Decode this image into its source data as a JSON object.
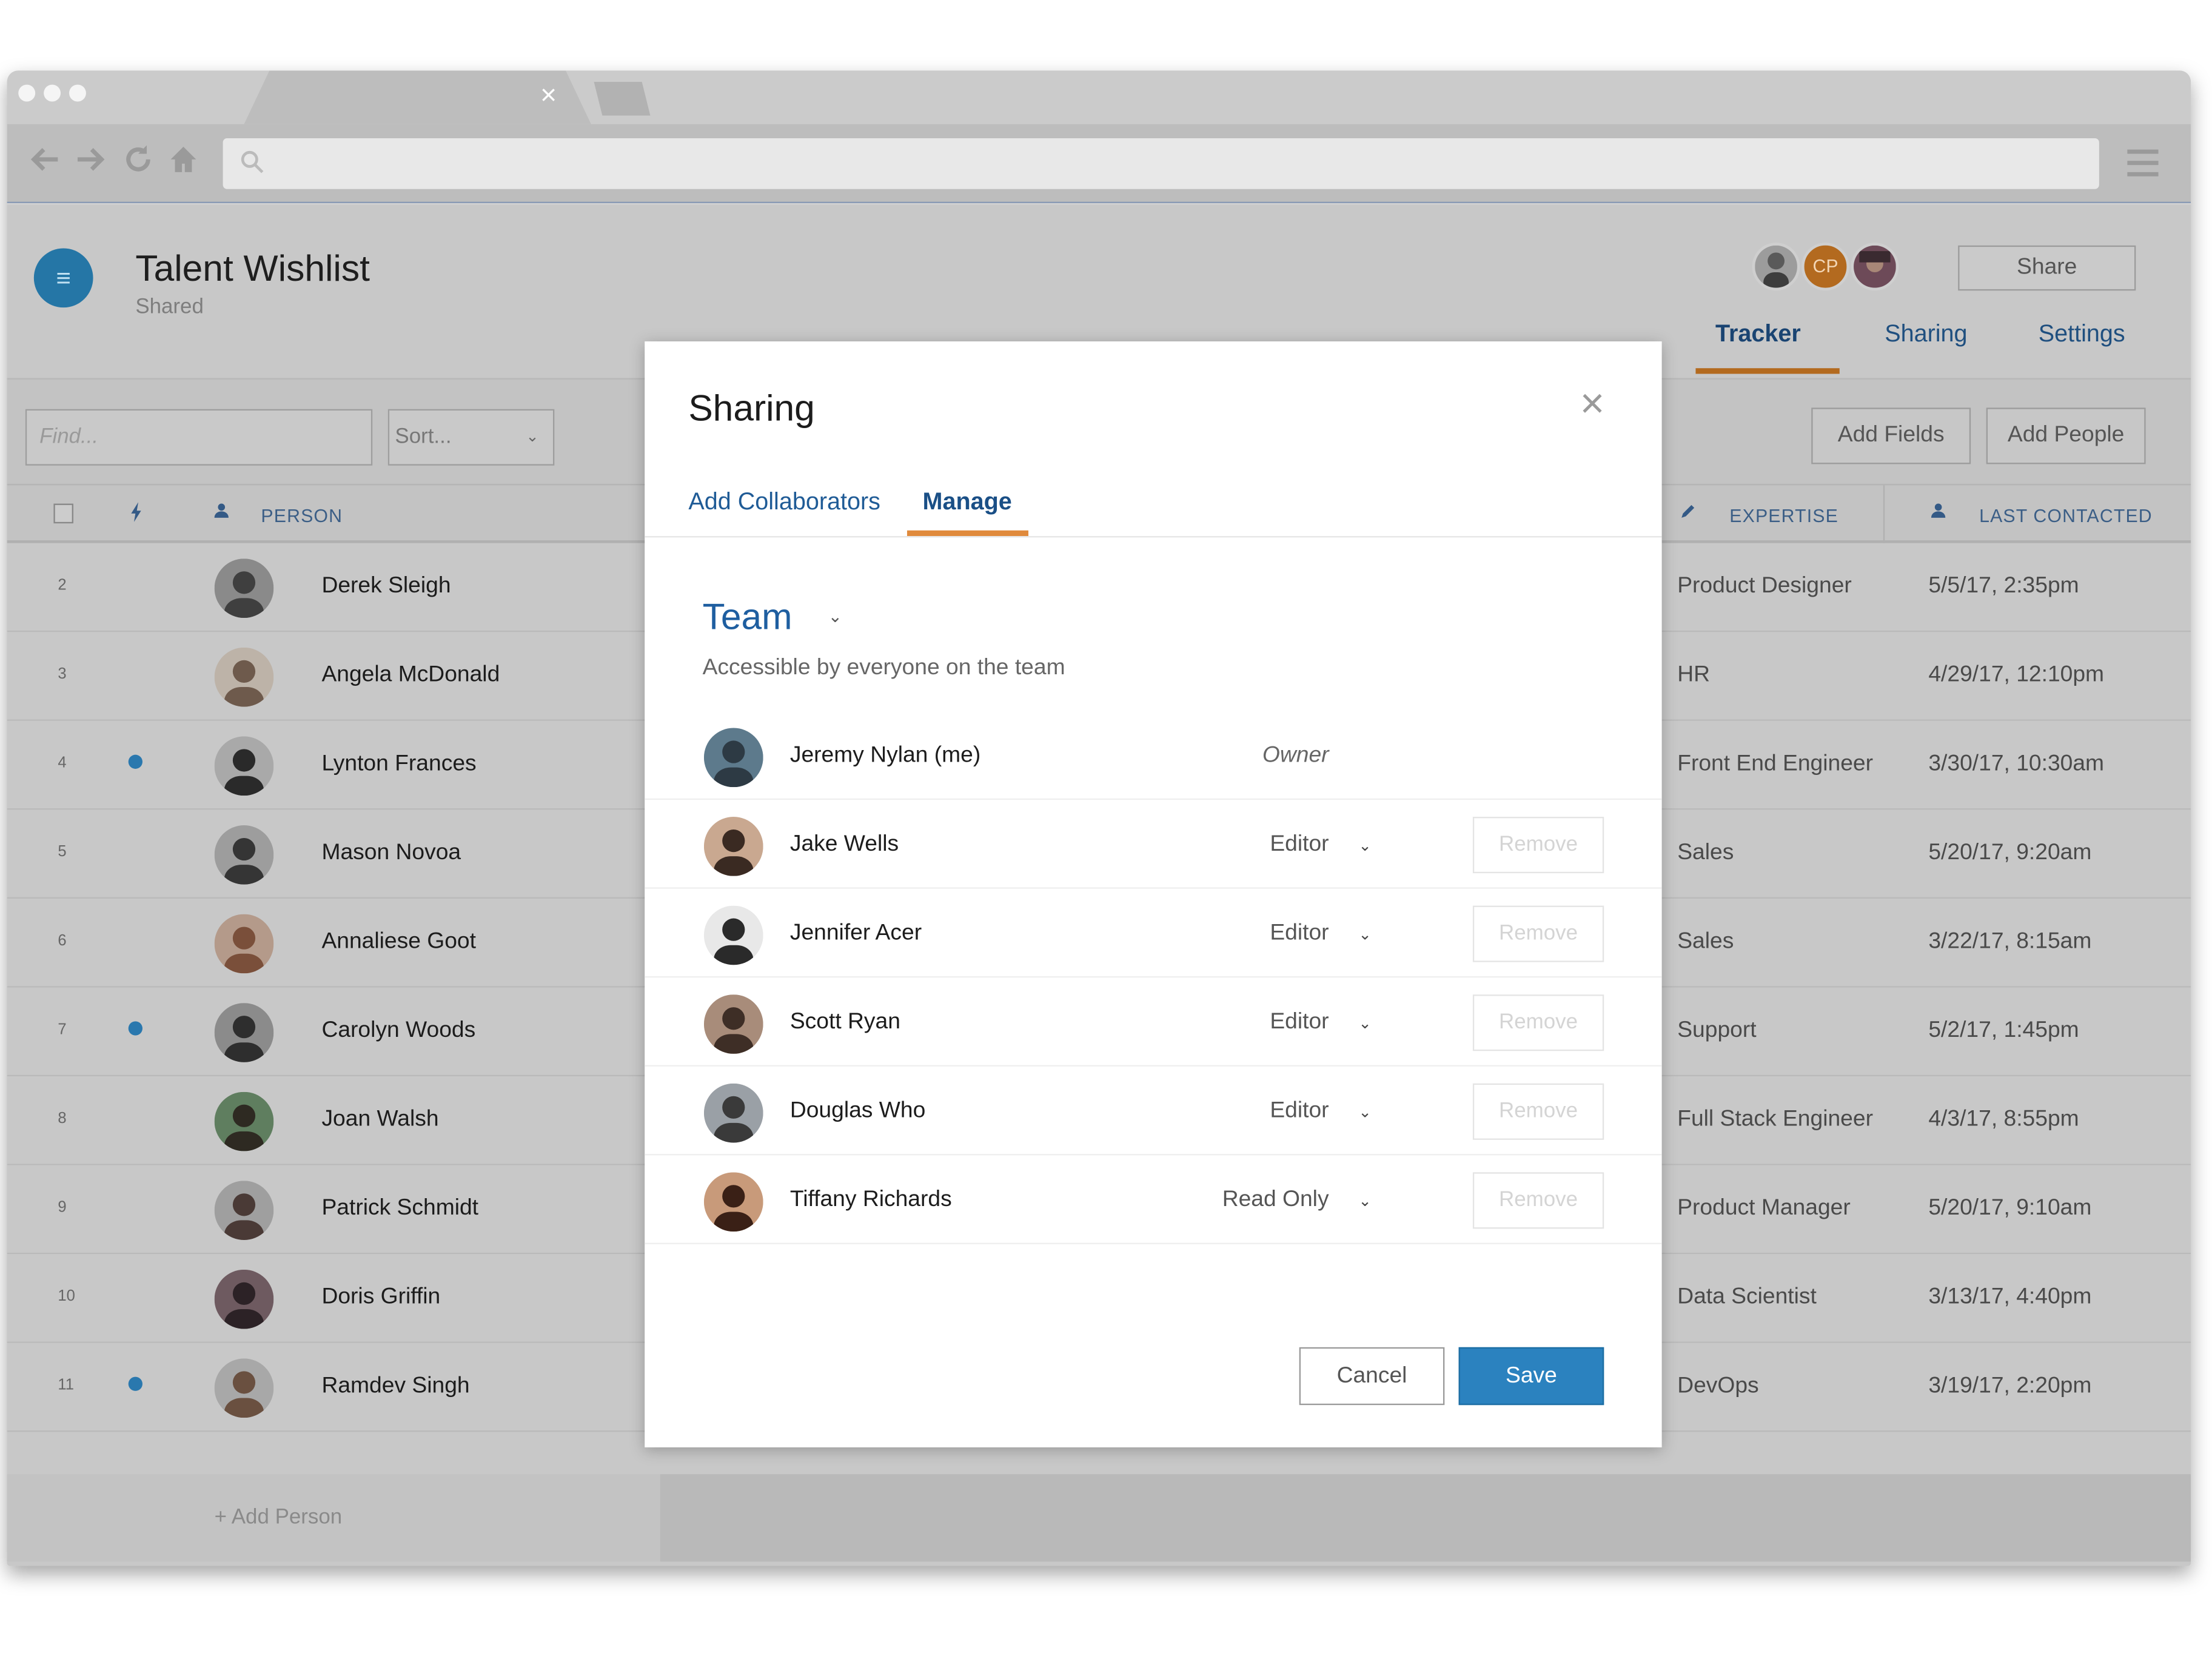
{
  "colors": {
    "accent_blue": "#2b82bf",
    "tab_underline_orange": "#e08a3c",
    "link_blue": "#1f5b96",
    "overlay_gray": "#c8c8c8",
    "status_dot": "#2a78ae"
  },
  "browser": {
    "tab_close": "×",
    "icons": [
      "back-arrow-icon",
      "forward-arrow-icon",
      "reload-icon",
      "home-icon",
      "search-icon",
      "hamburger-menu-icon"
    ]
  },
  "app": {
    "menu_glyph": "≡",
    "title": "Talent Wishlist",
    "subtitle": "Shared",
    "collaborator_initials": "CP",
    "share_label": "Share",
    "tabs": [
      {
        "label": "Tracker",
        "active": true
      },
      {
        "label": "Sharing",
        "active": false
      },
      {
        "label": "Settings",
        "active": false
      }
    ],
    "find_placeholder": "Find...",
    "sort_label": "Sort...",
    "chevron": "⌄",
    "add_fields_label": "Add Fields",
    "add_people_label": "Add People",
    "columns": {
      "person": "PERSON",
      "expertise": "EXPERTISE",
      "last_contacted": "LAST CONTACTED"
    },
    "rows": [
      {
        "num": "2",
        "dot": false,
        "name": "Derek Sleigh",
        "expertise": "Product Designer",
        "last_contacted": "5/5/17, 2:35pm"
      },
      {
        "num": "3",
        "dot": false,
        "name": "Angela McDonald",
        "expertise": "HR",
        "last_contacted": "4/29/17, 12:10pm"
      },
      {
        "num": "4",
        "dot": true,
        "name": "Lynton Frances",
        "expertise": "Front End Engineer",
        "last_contacted": "3/30/17, 10:30am"
      },
      {
        "num": "5",
        "dot": false,
        "name": "Mason Novoa",
        "expertise": "Sales",
        "last_contacted": "5/20/17, 9:20am"
      },
      {
        "num": "6",
        "dot": false,
        "name": "Annaliese Goot",
        "expertise": "Sales",
        "last_contacted": "3/22/17, 8:15am"
      },
      {
        "num": "7",
        "dot": true,
        "name": "Carolyn Woods",
        "expertise": "Support",
        "last_contacted": "5/2/17, 1:45pm"
      },
      {
        "num": "8",
        "dot": false,
        "name": "Joan Walsh",
        "expertise": "Full Stack Engineer",
        "last_contacted": "4/3/17, 8:55pm"
      },
      {
        "num": "9",
        "dot": false,
        "name": "Patrick Schmidt",
        "expertise": "Product Manager",
        "last_contacted": "5/20/17, 9:10am"
      },
      {
        "num": "10",
        "dot": false,
        "name": "Doris Griffin",
        "expertise": "Data Scientist",
        "last_contacted": "3/13/17, 4:40pm"
      },
      {
        "num": "11",
        "dot": true,
        "name": "Ramdev Singh",
        "expertise": "DevOps",
        "last_contacted": "3/19/17, 2:20pm"
      }
    ],
    "add_person_label": "+ Add Person"
  },
  "modal": {
    "title": "Sharing",
    "close_glyph": "×",
    "tabs": [
      {
        "label": "Add Collaborators",
        "active": false
      },
      {
        "label": "Manage",
        "active": true
      }
    ],
    "team_label": "Team",
    "team_chevron": "⌄",
    "team_description": "Accessible by everyone on the team",
    "members": [
      {
        "name": "Jeremy Nylan (me)",
        "role": "Owner",
        "owner": true
      },
      {
        "name": "Jake Wells",
        "role": "Editor",
        "owner": false
      },
      {
        "name": "Jennifer Acer",
        "role": "Editor",
        "owner": false
      },
      {
        "name": "Scott Ryan",
        "role": "Editor",
        "owner": false
      },
      {
        "name": "Douglas Who",
        "role": "Editor",
        "owner": false
      },
      {
        "name": "Tiffany Richards",
        "role": "Read Only",
        "owner": false
      }
    ],
    "role_chevron": "⌄",
    "remove_label": "Remove",
    "cancel_label": "Cancel",
    "save_label": "Save"
  }
}
